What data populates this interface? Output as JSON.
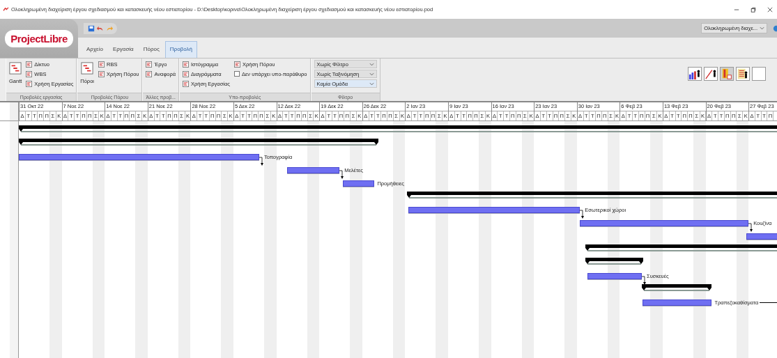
{
  "window": {
    "title": "Ολοκληρωμένη διαχείριση έργου σχεδιασμού και κατασκευής νέου εστιατορίου - D:\\Desktop\\κορινα\\Ολοκληρωμένη διαχείριση έργου σχεδιασμού και κατασκευής νέου εστιατορίου.pod"
  },
  "app": {
    "logo": "ProjectLibre"
  },
  "project_selector": {
    "value": "Ολοκληρωμένη διαχε..."
  },
  "tabs": [
    {
      "label": "Αρχείο",
      "selected": false
    },
    {
      "label": "Εργασία",
      "selected": false
    },
    {
      "label": "Πόρος",
      "selected": false
    },
    {
      "label": "Προβολή",
      "selected": true
    }
  ],
  "ribbon": [
    {
      "label": "Προβολές εργασίας",
      "columns": [
        [
          {
            "kind": "large",
            "label": "Gantt"
          }
        ],
        [
          {
            "kind": "small",
            "label": "Δίκτυο"
          },
          {
            "kind": "small",
            "label": "WBS"
          },
          {
            "kind": "small",
            "label": "Χρήση Εργασίας"
          }
        ]
      ]
    },
    {
      "label": "Προβολές Πόρου",
      "columns": [
        [
          {
            "kind": "large",
            "label": "Πόροι"
          }
        ],
        [
          {
            "kind": "small",
            "label": "RBS"
          },
          {
            "kind": "small",
            "label": "Χρήση Πόρου"
          }
        ]
      ]
    },
    {
      "label": "Άλλες προβ...",
      "columns": [
        [
          {
            "kind": "small",
            "label": "Έργο"
          },
          {
            "kind": "small",
            "label": "Αναφορά"
          }
        ]
      ]
    },
    {
      "label": "Υπο-προβολές",
      "columns": [
        [
          {
            "kind": "small",
            "label": "Ιστόγραμμα"
          },
          {
            "kind": "small",
            "label": "Διαγράμματα"
          },
          {
            "kind": "small",
            "label": "Χρήση Εργασίας"
          }
        ],
        [
          {
            "kind": "small",
            "label": "Χρήση Πόρου"
          },
          {
            "kind": "checkbox",
            "label": "Δεν υπάρχει υπο-παράθυρο",
            "checked": false
          }
        ]
      ]
    },
    {
      "label": "Φίλτρο",
      "columns": [
        [
          {
            "kind": "dropdown",
            "value": "Χωρίς Φίλτρο",
            "focused": false
          },
          {
            "kind": "dropdown",
            "value": "Χωρίς Ταξινόμηση",
            "focused": false
          },
          {
            "kind": "dropdown",
            "value": "Καμία Ομάδα",
            "focused": true
          }
        ]
      ]
    }
  ],
  "timeline": {
    "weeks": [
      {
        "label": "31 Οκτ 22",
        "days": [
          "Δ",
          "Τ",
          "Τ",
          "Π",
          "Π",
          "Σ",
          "Κ"
        ]
      },
      {
        "label": "7 Νοε 22",
        "days": [
          "Δ",
          "Τ",
          "Τ",
          "Π",
          "Π",
          "Σ",
          "Κ"
        ]
      },
      {
        "label": "14 Νοε 22",
        "days": [
          "Δ",
          "Τ",
          "Τ",
          "Π",
          "Π",
          "Σ",
          "Κ"
        ]
      },
      {
        "label": "21 Νοε 22",
        "days": [
          "Δ",
          "Τ",
          "Τ",
          "Π",
          "Π",
          "Σ",
          "Κ"
        ]
      },
      {
        "label": "28 Νοε 22",
        "days": [
          "Δ",
          "Τ",
          "Τ",
          "Π",
          "Π",
          "Σ",
          "Κ"
        ]
      },
      {
        "label": "5 Δεκ 22",
        "days": [
          "Δ",
          "Τ",
          "Τ",
          "Π",
          "Π",
          "Σ",
          "Κ"
        ]
      },
      {
        "label": "12 Δεκ 22",
        "days": [
          "Δ",
          "Τ",
          "Τ",
          "Π",
          "Π",
          "Σ",
          "Κ"
        ]
      },
      {
        "label": "19 Δεκ 22",
        "days": [
          "Δ",
          "Τ",
          "Τ",
          "Π",
          "Π",
          "Σ",
          "Κ"
        ]
      },
      {
        "label": "26 Δεκ 22",
        "days": [
          "Δ",
          "Τ",
          "Τ",
          "Π",
          "Π",
          "Σ",
          "Κ"
        ]
      },
      {
        "label": "2 Ιαν 23",
        "days": [
          "Δ",
          "Τ",
          "Τ",
          "Π",
          "Π",
          "Σ",
          "Κ"
        ]
      },
      {
        "label": "9 Ιαν 23",
        "days": [
          "Δ",
          "Τ",
          "Τ",
          "Π",
          "Π",
          "Σ",
          "Κ"
        ]
      },
      {
        "label": "16 Ιαν 23",
        "days": [
          "Δ",
          "Τ",
          "Τ",
          "Π",
          "Π",
          "Σ",
          "Κ"
        ]
      },
      {
        "label": "23 Ιαν 23",
        "days": [
          "Δ",
          "Τ",
          "Τ",
          "Π",
          "Π",
          "Σ",
          "Κ"
        ]
      },
      {
        "label": "30 Ιαν 23",
        "days": [
          "Δ",
          "Τ",
          "Τ",
          "Π",
          "Π",
          "Σ",
          "Κ"
        ]
      },
      {
        "label": "6 Φεβ 23",
        "days": [
          "Δ",
          "Τ",
          "Τ",
          "Π",
          "Π",
          "Σ",
          "Κ"
        ]
      },
      {
        "label": "13 Φεβ 23",
        "days": [
          "Δ",
          "Τ",
          "Τ",
          "Π",
          "Π",
          "Σ",
          "Κ"
        ]
      },
      {
        "label": "20 Φεβ 23",
        "days": [
          "Δ",
          "Τ",
          "Τ",
          "Π",
          "Π",
          "Σ",
          "Κ"
        ]
      },
      {
        "label": "27 Φεβ 23",
        "days": [
          "Δ",
          "Τ",
          "Τ",
          "Π"
        ]
      }
    ]
  },
  "gantt": [
    {
      "kind": "summary"
    },
    {
      "kind": "summary"
    },
    {
      "kind": "task",
      "label": "Τοπογραφία",
      "linked": true
    },
    {
      "kind": "task",
      "label": "Μελέτες",
      "linked": true
    },
    {
      "kind": "task",
      "label": "Προμήθειες",
      "linked": false
    },
    {
      "kind": "summary"
    },
    {
      "kind": "task",
      "label": "Εσωτερικοί χώροι",
      "linked": true
    },
    {
      "kind": "task",
      "label": "Κουζίνα",
      "linked": true
    },
    {
      "kind": "task",
      "linked": false
    },
    {
      "kind": "summary"
    },
    {
      "kind": "summary"
    },
    {
      "kind": "task",
      "label": "Συσκευές",
      "linked": true
    },
    {
      "kind": "summary"
    },
    {
      "kind": "task",
      "label": "Τραπεζοκαθίσματα",
      "linked": false,
      "trailing_line": true
    }
  ]
}
